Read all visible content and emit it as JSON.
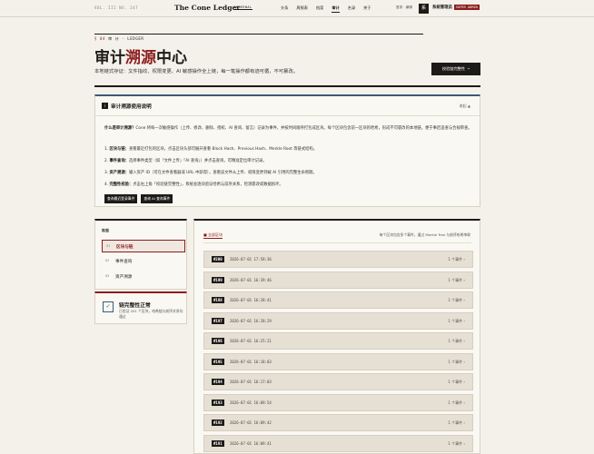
{
  "topbar": {
    "issue": "VOL. III  NO. 247",
    "brand": "The Cone Ledger",
    "badge": "INTERNAL",
    "nav": [
      {
        "label": "头条",
        "active": false
      },
      {
        "label": "周报表",
        "active": false
      },
      {
        "label": "档案",
        "active": false
      },
      {
        "label": "审计",
        "active": true
      },
      {
        "label": "名录",
        "active": false
      },
      {
        "label": "关于",
        "active": false
      }
    ],
    "user_label": "登录 · 编辑",
    "avatar_letter": "系",
    "user_name": "系统管理员",
    "role_badge": "SUPER ADMIN"
  },
  "header": {
    "eyebrow_num": "§ 04",
    "eyebrow_text": "审 计 · LEDGER",
    "title_pre": "审计",
    "title_accent": "溯源",
    "title_post": "中心",
    "subtitle": "本地链式存证：文件指纹、权限变更、AI 敏感操作全上链，每一笔操作都有迹可循，不可篡改。",
    "verify_button": "校验链完整性 →"
  },
  "guide": {
    "icon": "i",
    "title": "审计溯源使用说明",
    "collapse_label": "收起 ▲",
    "intro_bold": "什么是审计溯源？",
    "intro": "Cone 将每一次敏感操作（上传、修改、删除、授权、AI 查询、留言）记录为事件，并按时间顺序打包成区块。每个区块包含前一区块的哈希，形成不可篡改的本地链，便于事后追查与合规审查。",
    "steps": [
      {
        "bold": "区块与链：",
        "text": "查看最近打包的区块，点击区块头部可展开查看 Block Hash、Previous Hash、Merkle Root 等链式结构。"
      },
      {
        "bold": "事件查询：",
        "text": "选择事件类型（如「文件上传」「AI 查询」）并点击查询，可精准定位审计记录。"
      },
      {
        "bold": "资产溯源：",
        "text": "输入资产 ID（可在文件查看器或 URL 中获得），查看该文件从上传、权限变更到被 AI 引用的完整生命周期。"
      },
      {
        "bold": "完整性校验：",
        "text": "点击右上角「校验链完整性」，系统会逐块验证哈希与前序关系，检测篡改或数据损坏。"
      }
    ],
    "buttons": [
      "查询最近登录事件",
      "查询 AI 查询事件"
    ]
  },
  "left_panel": {
    "heading": "视图",
    "tabs": [
      {
        "index": "01",
        "label": "区块与链",
        "active": true
      },
      {
        "index": "02",
        "label": "事件查询",
        "active": false
      },
      {
        "index": "03",
        "label": "资产溯源",
        "active": false
      }
    ]
  },
  "status": {
    "icon": "✓",
    "title": "链完整性正常",
    "desc": "已验证 201 个区块，哈希链与前序关系均通过"
  },
  "right_panel": {
    "tab_label": "■ 全部区块",
    "desc": "每个区块包含多个事件，通过 Merkle Tree 与前序哈希串联",
    "blocks": [
      {
        "num": "#200",
        "time": "2026-07-01 17:58:36",
        "count": "1 个事件 ›"
      },
      {
        "num": "#199",
        "time": "2026-07-01 16:39:46",
        "count": "1 个事件 ›"
      },
      {
        "num": "#198",
        "time": "2026-07-01 16:28:41",
        "count": "1 个事件 ›"
      },
      {
        "num": "#197",
        "time": "2026-07-01 16:28:29",
        "count": "1 个事件 ›"
      },
      {
        "num": "#196",
        "time": "2026-07-01 16:25:21",
        "count": "1 个事件 ›"
      },
      {
        "num": "#195",
        "time": "2026-07-01 16:18:03",
        "count": "1 个事件 ›"
      },
      {
        "num": "#194",
        "time": "2026-07-01 16:17:03",
        "count": "1 个事件 ›"
      },
      {
        "num": "#193",
        "time": "2026-07-01 16:09:54",
        "count": "1 个事件 ›"
      },
      {
        "num": "#192",
        "time": "2026-07-01 16:09:42",
        "count": "1 个事件 ›"
      },
      {
        "num": "#191",
        "time": "2026-07-01 16:09:41",
        "count": "1 个事件 ›"
      }
    ]
  }
}
